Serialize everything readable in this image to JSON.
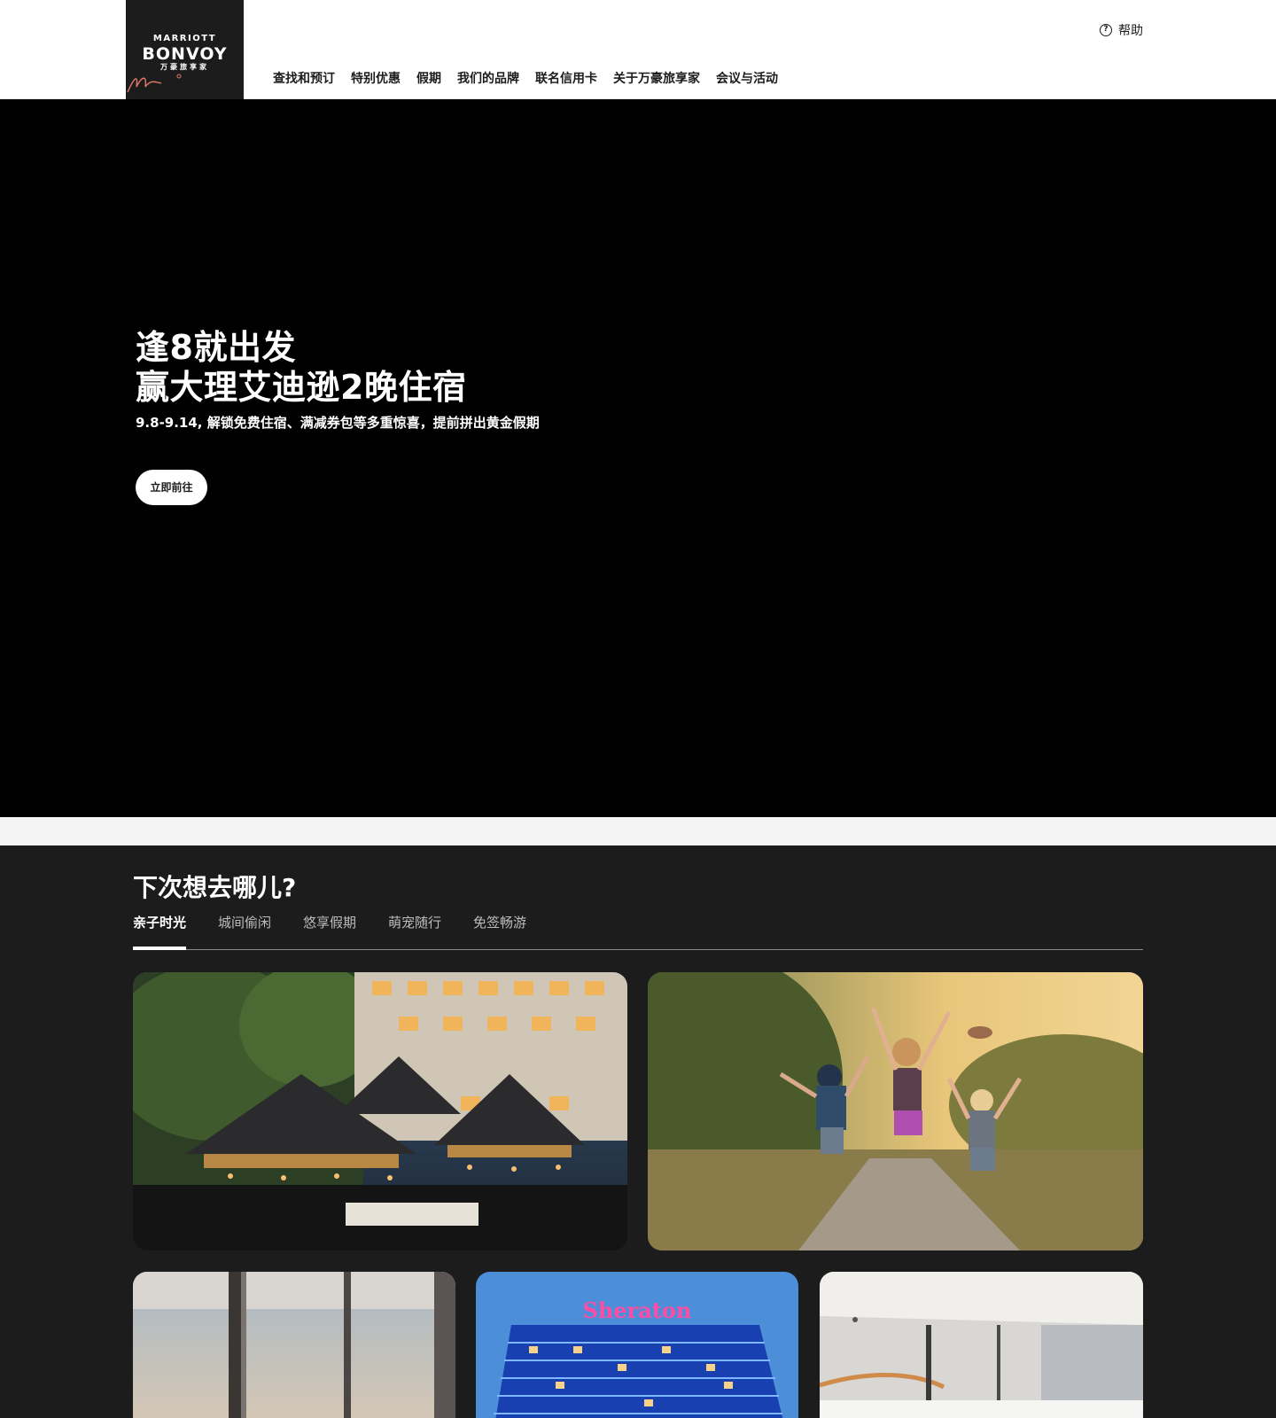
{
  "logo": {
    "line1": "MARRIOTT",
    "line2": "BONVOY",
    "line3": "万豪旅享家"
  },
  "nav": [
    "查找和预订",
    "特别优惠",
    "假期",
    "我们的品牌",
    "联名信用卡",
    "关于万豪旅享家",
    "会议与活动"
  ],
  "help": {
    "label": "帮助",
    "icon": "help-circle-icon"
  },
  "hero": {
    "title_line1": "逢8就出发",
    "title_line2": "赢大理艾迪逊2晚住宿",
    "subtitle": "9.8-9.14, 解锁免费住宿、满减券包等多重惊喜，提前拼出黄金假期",
    "button": "立即前往"
  },
  "destinations": {
    "title": "下次想去哪儿?",
    "tabs": [
      "亲子时光",
      "城间偷闲",
      "悠享假期",
      "萌宠随行",
      "免签畅游"
    ],
    "active_tab": 0,
    "cards": [
      {
        "image": "resort-pavilions-night-photo"
      },
      {
        "image": "children-jumping-trail-photo"
      },
      {
        "image": "hotel-window-view-photo"
      },
      {
        "image": "sheraton-hotel-building-photo",
        "sign_text": "Sheraton"
      },
      {
        "image": "modern-interior-photo"
      }
    ]
  },
  "colors": {
    "hero_bg": "#000000",
    "section_bg": "#1c1c1c",
    "logo_bg": "#1c1c1c",
    "accent": "#e0796a"
  }
}
